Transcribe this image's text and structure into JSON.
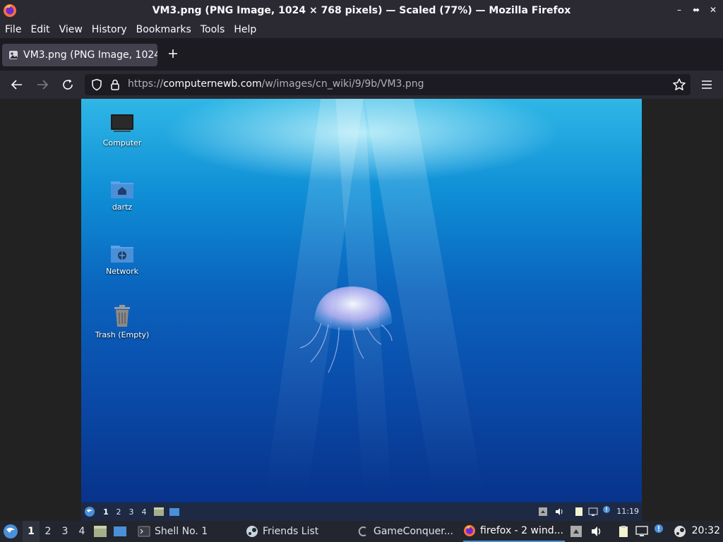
{
  "window": {
    "title": "VM3.png (PNG Image, 1024 × 768 pixels) — Scaled (77%) — Mozilla Firefox"
  },
  "menu": {
    "items": [
      "File",
      "Edit",
      "View",
      "History",
      "Bookmarks",
      "Tools",
      "Help"
    ]
  },
  "tabs": [
    {
      "title": "VM3.png (PNG Image, 1024 × 768 pixels)"
    }
  ],
  "urlbar": {
    "prefix": "https://",
    "host": "computernewb.com",
    "path": "/w/images/cn_wiki/9/9b/VM3.png"
  },
  "vm_desktop": {
    "icons": [
      "Computer",
      "dartz",
      "Network",
      "Trash (Empty)"
    ],
    "panel": {
      "workspaces": [
        "1",
        "2",
        "3",
        "4"
      ],
      "clock": "11:19"
    }
  },
  "taskbar": {
    "workspaces": [
      "1",
      "2",
      "3",
      "4"
    ],
    "tasks": [
      {
        "label": "Shell No. 1",
        "icon": "terminal-icon"
      },
      {
        "label": "Friends List",
        "icon": "steam-icon"
      },
      {
        "label": "GameConquer...",
        "icon": "gameconqueror-icon"
      },
      {
        "label": "firefox - 2 wind...",
        "icon": "firefox-icon"
      }
    ],
    "clock": "20:32"
  },
  "colors": {
    "chrome_bg": "#2b2a33",
    "tab_active": "#42414d",
    "taskbar_bg": "#23262e",
    "accent": "#4a90d9"
  }
}
